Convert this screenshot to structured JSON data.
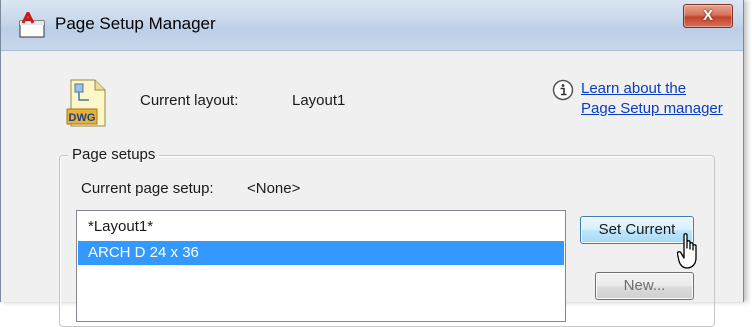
{
  "window": {
    "title": "Page Setup Manager",
    "close_label": "X"
  },
  "current_layout": {
    "label": "Current layout:",
    "value": "Layout1",
    "file_icon_text": "DWG"
  },
  "help_link": {
    "line1": "Learn about the",
    "line2": "Page Setup manager"
  },
  "page_setups": {
    "group_label": "Page setups",
    "current_label": "Current page setup:",
    "current_value": "<None>",
    "items": [
      {
        "label": "*Layout1*",
        "selected": false
      },
      {
        "label": "ARCH D 24 x 36",
        "selected": true
      }
    ]
  },
  "buttons": {
    "set_current": "Set Current",
    "new": "New..."
  },
  "colors": {
    "selection": "#3399ff",
    "link": "#0a3cc2",
    "close_button": "#c2432a"
  }
}
